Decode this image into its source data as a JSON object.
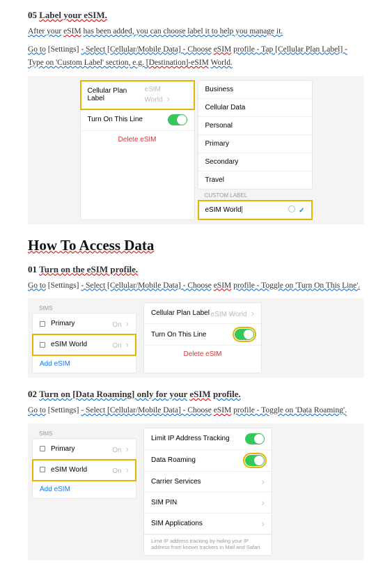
{
  "sec05": {
    "num": "05",
    "title": "Label your eSIM.",
    "p1a": "After your",
    "p1b": "eSIM",
    "p1c": "has been added, you can choose label it to help you manage it.",
    "p2a": "Go to",
    "p2b": "[Settings]",
    "p2c": "- Select [Cellular/Mobile Data] - Choose",
    "p2d": "eSIM",
    "p2e": "profile - Tap [Cellular Plan Label] - Type on 'Custom Label' section, e.g. [",
    "p2f": "Destination]-eSIM",
    "p2g": "World."
  },
  "ios1": {
    "left": {
      "plan_label": "Cellular Plan Label",
      "plan_value": "eSIM World",
      "turn_on": "Turn On This Line",
      "delete": "Delete eSIM"
    },
    "right": {
      "opts": [
        "Business",
        "Cellular Data",
        "Personal",
        "Primary",
        "Secondary",
        "Travel"
      ],
      "custom_hdr": "CUSTOM LABEL",
      "custom_val": "eSIM World"
    }
  },
  "heading": "How To Access Data",
  "sec01": {
    "num": "01",
    "title": "Turn on the eSIM profile.",
    "p_a": "Go to",
    "p_b": "[Settings]",
    "p_c": "- Select [Cellular/Mobile Data] - Choose",
    "p_d": "eSIM",
    "p_e": "profile - Toggle on 'Turn On This Line'."
  },
  "ios2": {
    "left": {
      "hdr": "SIMs",
      "primary": "Primary",
      "primary_state": "On",
      "esim": "eSIM World",
      "esim_state": "On",
      "add": "Add eSIM"
    },
    "right": {
      "plan_label": "Cellular Plan Label",
      "plan_value": "eSIM World",
      "turn_on": "Turn On This Line",
      "delete": "Delete eSIM"
    }
  },
  "sec02": {
    "num": "02",
    "title_a": "Turn on [Data Roaming] only for your",
    "title_b": "eSIM",
    "title_c": "profile.",
    "p_a": "Go to",
    "p_b": "[Settings]",
    "p_c": "- Select [Cellular/Mobile Data] - Choose",
    "p_d": "eSIM",
    "p_e": "profile - Toggle on 'Data Roaming'."
  },
  "ios3": {
    "left": {
      "hdr": "SIMs",
      "primary": "Primary",
      "primary_state": "On",
      "esim": "eSIM World",
      "esim_state": "On",
      "add": "Add eSIM"
    },
    "right": {
      "limit": "Limit IP Address Tracking",
      "roaming": "Data Roaming",
      "carrier": "Carrier Services",
      "pin": "SIM PIN",
      "apps": "SIM Applications",
      "note": "Limit IP address tracking by hiding your IP address from known trackers in Mail and Safari."
    }
  }
}
